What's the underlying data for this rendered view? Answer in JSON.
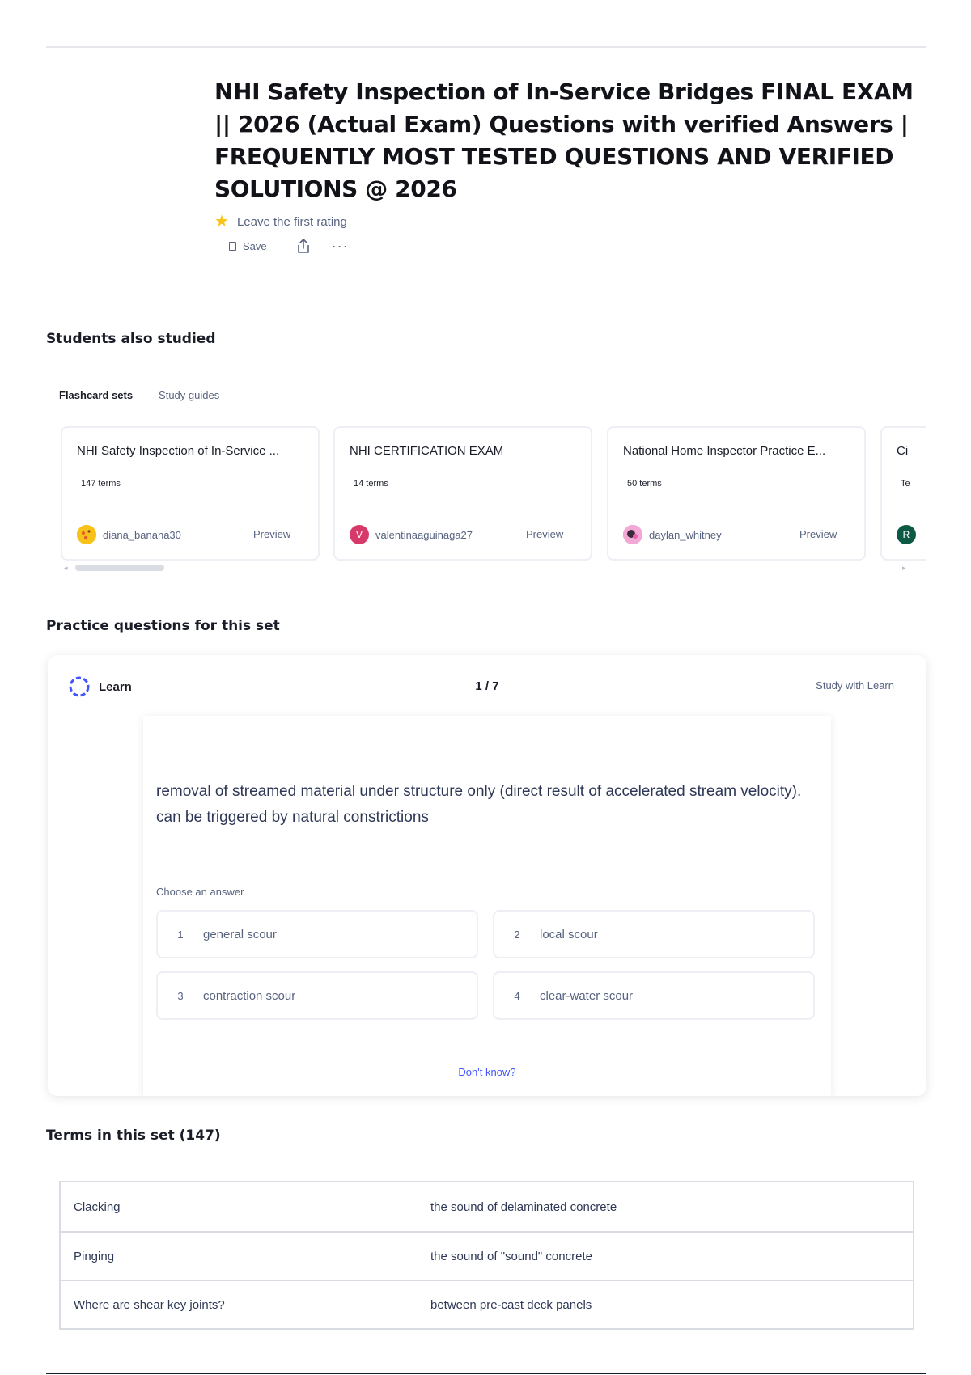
{
  "header": {
    "title_lines": [
      "NHI Safety Inspection of In-Service Bridges FINAL EXAM",
      "|| 2026 (Actual Exam) Questions with verified Answers |",
      "FREQUENTLY MOST TESTED QUESTIONS AND VERIFIED",
      "SOLUTIONS @ 2026"
    ],
    "rating_text": "Leave the first rating",
    "save_label": "Save"
  },
  "students_section": {
    "title": "Students also studied",
    "tabs": [
      "Flashcard sets",
      "Study guides"
    ],
    "cards": [
      {
        "title": "NHI Safety Inspection of In-Service ...",
        "terms": "147 terms",
        "user": "diana_banana30",
        "avatar_letter": "",
        "avatar_color": "#f7c21a",
        "preview": "Preview"
      },
      {
        "title": "NHI CERTIFICATION EXAM",
        "terms": "14 terms",
        "user": "valentinaaguinaga27",
        "avatar_letter": "V",
        "avatar_color": "#d63a6a",
        "preview": "Preview"
      },
      {
        "title": "National Home Inspector Practice E...",
        "terms": "50 terms",
        "user": "daylan_whitney",
        "avatar_letter": "",
        "avatar_color": "#e85fb0",
        "preview": "Preview"
      },
      {
        "title": "Ci",
        "terms": "Te",
        "user": "",
        "avatar_letter": "R",
        "avatar_color": "#0c5a44",
        "preview": ""
      }
    ]
  },
  "practice_section": {
    "title": "Practice questions for this set",
    "learn_label": "Learn",
    "progress": "1 / 7",
    "study_link": "Study with Learn",
    "question": "removal of streamed material under structure only (direct result of accelerated stream velocity). can be triggered by natural constrictions",
    "choose_label": "Choose an answer",
    "options": [
      {
        "num": "1",
        "text": "general scour"
      },
      {
        "num": "2",
        "text": "local scour"
      },
      {
        "num": "3",
        "text": "contraction scour"
      },
      {
        "num": "4",
        "text": "clear-water scour"
      }
    ],
    "dont_know": "Don't know?"
  },
  "terms_section": {
    "title": "Terms in this set (147)",
    "rows": [
      {
        "term": "Clacking",
        "definition": "the sound of delaminated concrete"
      },
      {
        "term": "Pinging",
        "definition": "the sound of \"sound\" concrete"
      },
      {
        "term": "Where are shear key joints?",
        "definition": "between pre-cast deck panels"
      }
    ]
  }
}
